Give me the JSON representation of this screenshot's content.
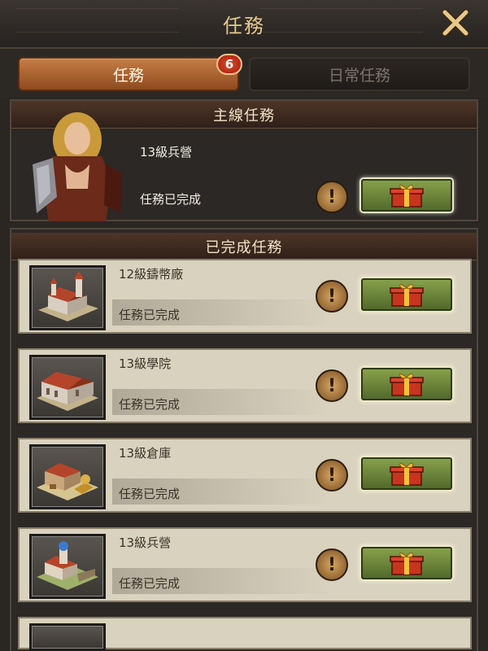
{
  "window": {
    "title": "任務"
  },
  "tabs": [
    {
      "label": "任務",
      "active": true
    },
    {
      "label": "日常任務",
      "active": false
    }
  ],
  "badge_count": "6",
  "main_quest": {
    "header": "主線任務",
    "name": "13級兵營",
    "status": "任務已完成"
  },
  "completed": {
    "header": "已完成任務",
    "items": [
      {
        "name": "12級鑄幣廠",
        "status": "任務已完成",
        "icon": "mint-building-icon"
      },
      {
        "name": "13級學院",
        "status": "任務已完成",
        "icon": "academy-building-icon"
      },
      {
        "name": "13級倉庫",
        "status": "任務已完成",
        "icon": "warehouse-building-icon"
      },
      {
        "name": "13級兵營",
        "status": "任務已完成",
        "icon": "barracks-building-icon"
      }
    ]
  },
  "colors": {
    "title_gold": "#e7c98e",
    "active_tab": "#b0663a",
    "claim_green": "#6f8a3a",
    "card_bg": "#d9d2bf"
  }
}
